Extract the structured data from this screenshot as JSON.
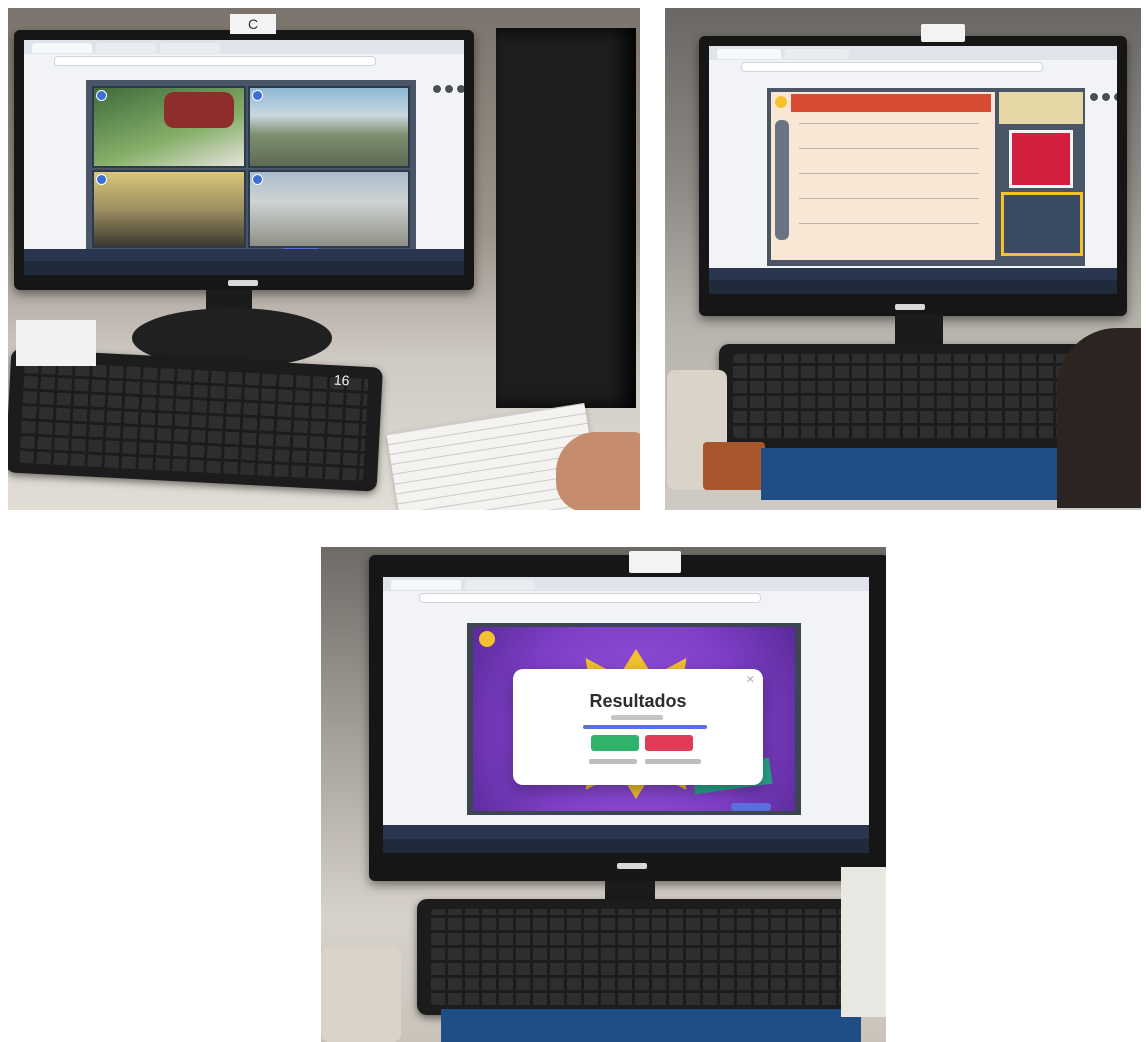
{
  "photos": [
    {
      "id": "photo-1",
      "labels": {
        "tag": "C",
        "note": "16"
      }
    },
    {
      "id": "photo-2",
      "labels": {}
    },
    {
      "id": "photo-3",
      "labels": {}
    }
  ],
  "results_modal": {
    "title": "Resultados",
    "progress": 1.0,
    "colors": {
      "accent": "#5b6ee1",
      "correct": "#2fb36a",
      "incorrect": "#e23b58",
      "banner": "#7f3fc9",
      "burst": "#f5c22f"
    }
  },
  "colors": {
    "slide_accent": "#d11f3d",
    "slide_panel": "#f7e7d4",
    "taskbar": "#1f2a3a"
  }
}
